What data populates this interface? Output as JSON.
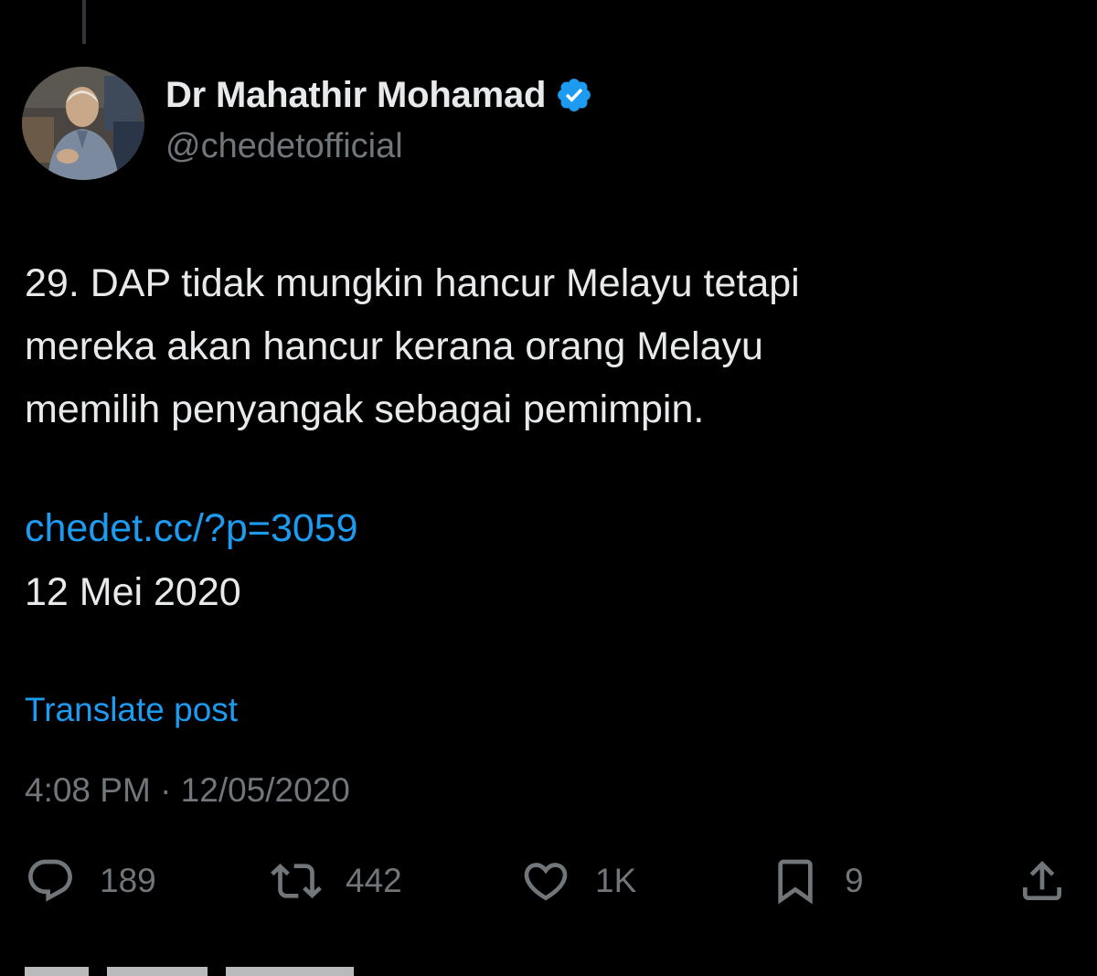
{
  "author": {
    "display_name": "Dr Mahathir Mohamad",
    "handle": "@chedetofficial",
    "verified": true,
    "verified_color": "#1d9bf0"
  },
  "tweet": {
    "text": "29. DAP tidak mungkin hancur Melayu tetapi\nmereka akan hancur kerana orang Melayu\nmemilih penyangak sebagai pemimpin.",
    "link": "chedet.cc/?p=3059",
    "date_line": "12 Mei 2020",
    "translate_label": "Translate post",
    "timestamp": "4:08 PM · 12/05/2020"
  },
  "actions": {
    "replies": {
      "icon": "reply-icon",
      "count": "189"
    },
    "reposts": {
      "icon": "repost-icon",
      "count": "442"
    },
    "likes": {
      "icon": "heart-icon",
      "count": "1K"
    },
    "bookmarks": {
      "icon": "bookmark-icon",
      "count": "9"
    },
    "share": {
      "icon": "share-icon"
    }
  },
  "colors": {
    "background": "#000000",
    "text": "#e7e9ea",
    "muted": "#71767b",
    "link": "#1d9bf0"
  }
}
